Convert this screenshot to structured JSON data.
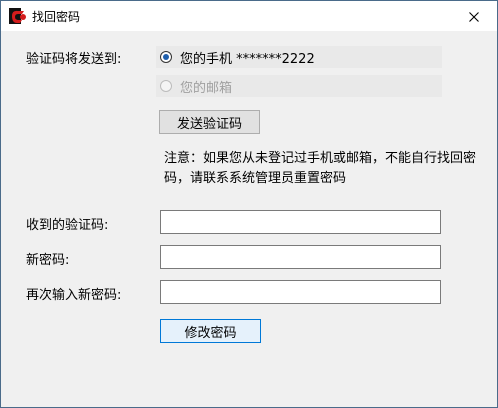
{
  "window": {
    "title": "找回密码"
  },
  "form": {
    "send_to_label": "验证码将发送到:",
    "phone_option_label": "您的手机 *******2222",
    "email_option_label": "您的邮箱",
    "send_button_label": "发送验证码",
    "note_text": "注意：如果您从未登记过手机或邮箱，不能自行找回密码，请联系系统管理员重置密码",
    "code_label": "收到的验证码:",
    "code_value": "",
    "new_password_label": "新密码:",
    "new_password_value": "",
    "confirm_password_label": "再次输入新密码:",
    "confirm_password_value": "",
    "submit_button_label": "修改密码"
  },
  "state": {
    "selected_option": "phone",
    "email_option_enabled": false
  },
  "colors": {
    "accent": "#0078d7",
    "radio_dot": "#1f5fad",
    "disabled_text": "#a0a0a0"
  }
}
